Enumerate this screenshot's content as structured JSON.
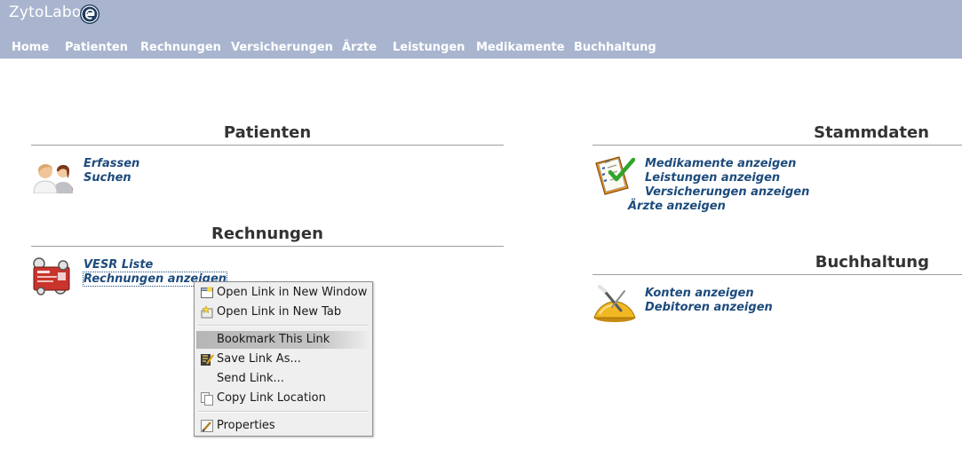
{
  "app": {
    "logo_text": "ZytoLabor"
  },
  "nav": {
    "items": [
      "Home",
      "Patienten",
      "Rechnungen",
      "Versicherungen",
      "Ärzte",
      "Leistungen",
      "Medikamente",
      "Buchhaltung"
    ]
  },
  "sections": {
    "patienten": {
      "title": "Patienten",
      "links": [
        "Erfassen",
        "Suchen"
      ]
    },
    "rechnungen": {
      "title": "Rechnungen",
      "links": [
        "VESR Liste",
        "Rechnungen anzeigen"
      ]
    },
    "stammdaten": {
      "title": "Stammdaten",
      "links": [
        "Medikamente anzeigen",
        "Leistungen anzeigen",
        "Versicherungen anzeigen",
        "Ärzte anzeigen"
      ]
    },
    "buchhaltung": {
      "title": "Buchhaltung",
      "links": [
        "Konten anzeigen",
        "Debitoren anzeigen"
      ]
    }
  },
  "context_menu": {
    "items": [
      {
        "label": "Open Link in New Window",
        "icon": "new-window-icon"
      },
      {
        "label": "Open Link in New Tab",
        "icon": "new-tab-icon"
      },
      {
        "label": "Bookmark This Link",
        "icon": ""
      },
      {
        "label": "Save Link As...",
        "icon": "save-icon"
      },
      {
        "label": "Send Link...",
        "icon": ""
      },
      {
        "label": "Copy Link Location",
        "icon": "copy-icon"
      },
      {
        "label": "Properties",
        "icon": "properties-icon"
      }
    ],
    "highlighted": "Bookmark This Link"
  },
  "colors": {
    "header_bg": "#a9b5cf",
    "link": "#1d4b7c",
    "title": "#333333"
  }
}
